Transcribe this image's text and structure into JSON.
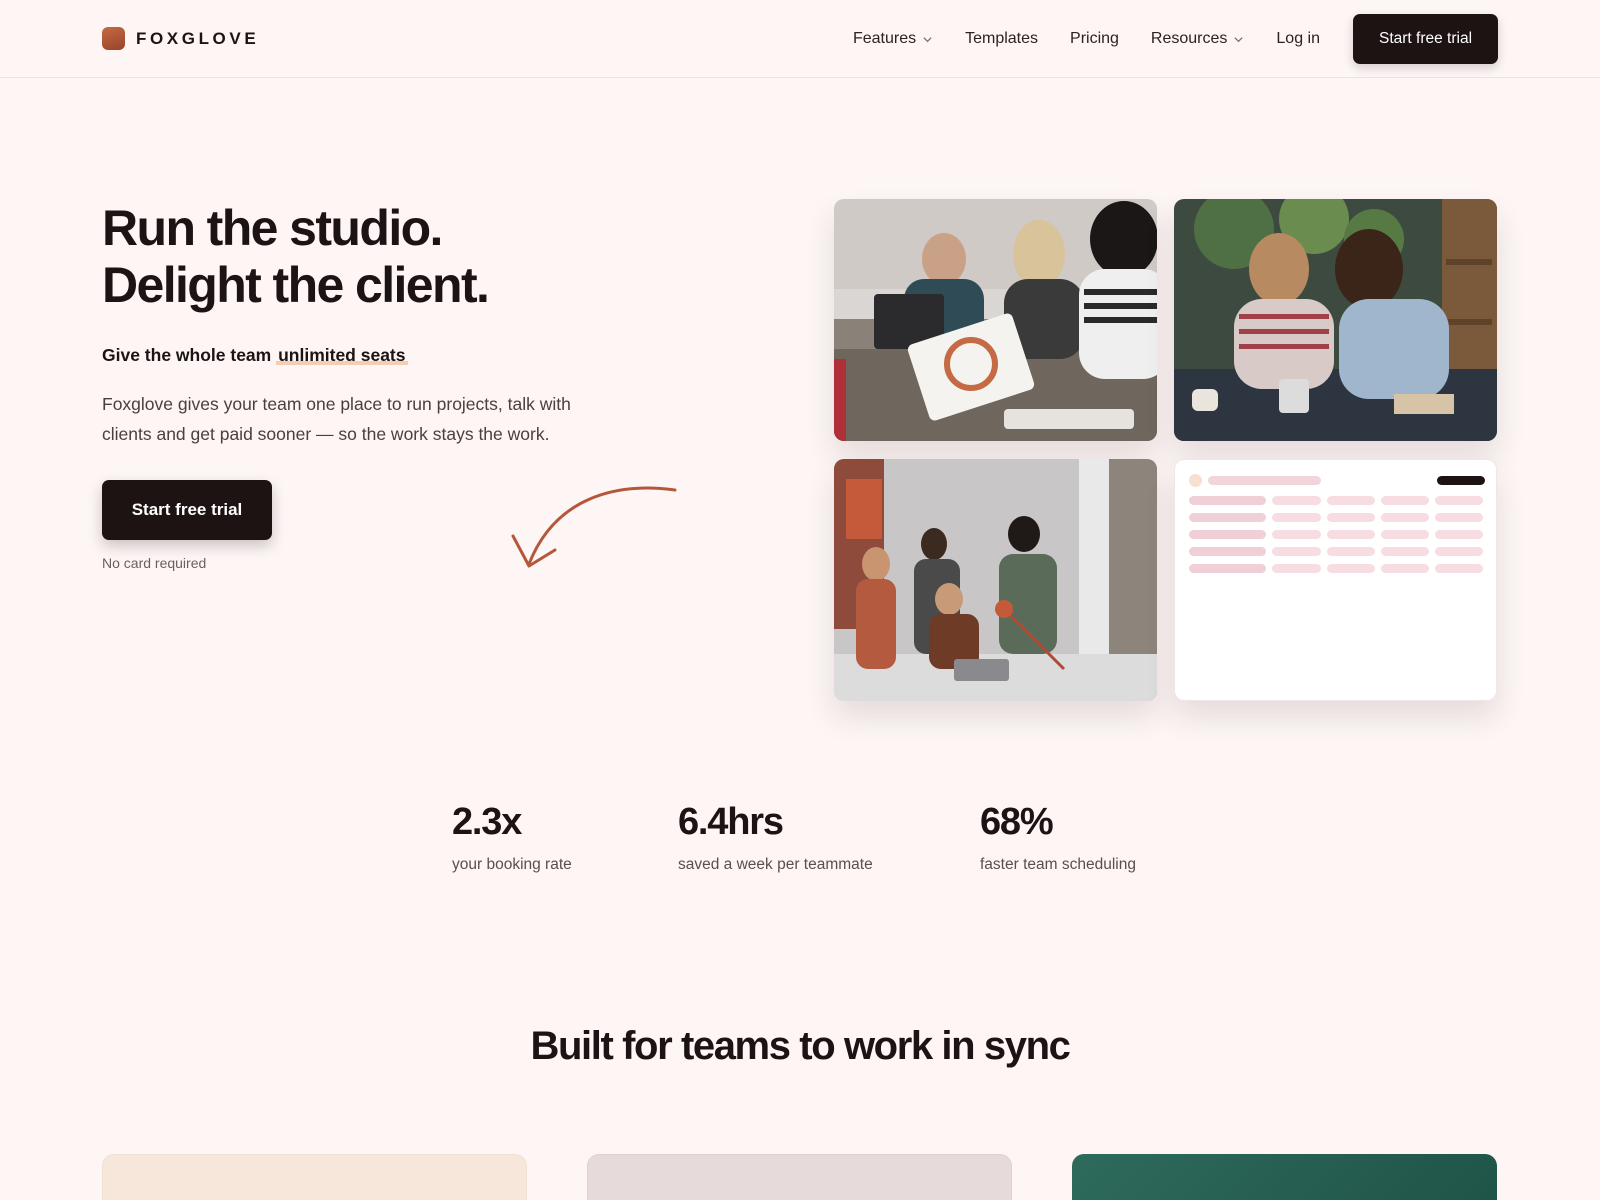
{
  "brand": {
    "name": "FOXGLOVE",
    "accent": "#b5573a",
    "dark": "#1e1313"
  },
  "nav": {
    "items": [
      {
        "label": "Features",
        "has_dropdown": true
      },
      {
        "label": "Templates",
        "has_dropdown": false
      },
      {
        "label": "Pricing",
        "has_dropdown": false
      },
      {
        "label": "Resources",
        "has_dropdown": true
      },
      {
        "label": "Log in",
        "has_dropdown": false
      }
    ],
    "cta_label": "Start free trial"
  },
  "hero": {
    "title_line1": "Run the studio.",
    "title_line2": "Delight the client.",
    "subtitle_prefix": "Give the whole team",
    "subtitle_highlight": "unlimited seats",
    "description": "Foxglove gives your team one place to run projects, talk with clients and get paid sooner — so the work stays the work.",
    "cta_label": "Start free trial",
    "note": "No card required"
  },
  "stats": [
    {
      "value": "2.3x",
      "label": "your booking rate"
    },
    {
      "value": "6.4hrs",
      "label": "saved a week per teammate"
    },
    {
      "value": "68%",
      "label": "faster team scheduling"
    }
  ],
  "section": {
    "title": "Built for teams to work in sync"
  }
}
